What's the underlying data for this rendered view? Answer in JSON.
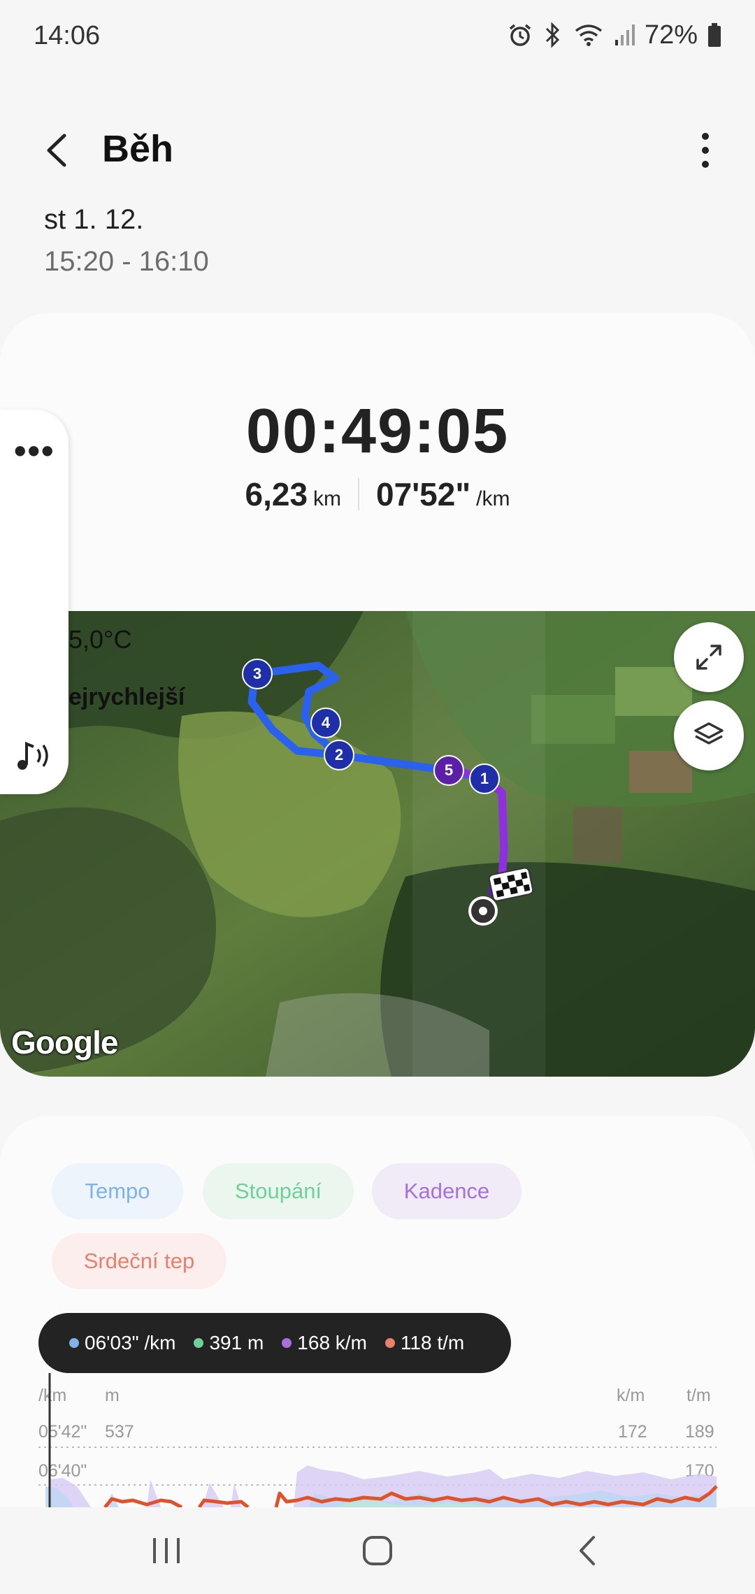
{
  "status": {
    "time": "14:06",
    "battery": "72%"
  },
  "header": {
    "title": "Běh"
  },
  "session": {
    "date": "st 1. 12.",
    "time_range": "15:20 - 16:10"
  },
  "summary": {
    "duration": "00:49:05",
    "distance_value": "6,23",
    "distance_unit": "km",
    "pace_value": "07'52\"",
    "pace_unit": "/km"
  },
  "map": {
    "temperature": "5,0°C",
    "fastest_label": "ejrychlejší",
    "attribution": "Google",
    "km_markers": [
      "1",
      "2",
      "3",
      "4",
      "5"
    ]
  },
  "chart": {
    "chips": {
      "tempo": "Tempo",
      "stoupani": "Stoupání",
      "kadence": "Kadence",
      "tep": "Srdeční tep"
    },
    "tooltip": {
      "pace": "06'03\" /km",
      "elevation": "391 m",
      "cadence": "168 k/m",
      "heart_rate": "118 t/m"
    },
    "axis_units": {
      "pace": "/km",
      "elevation": "m",
      "cadence": "k/m",
      "heart_rate": "t/m"
    },
    "ticks": {
      "pace_top": "05'42\"",
      "pace_second": "06'40\"",
      "elevation_top": "537",
      "cadence_top": "172",
      "heart_top": "189",
      "heart_second": "170"
    },
    "colors": {
      "pace": "#7fb2e8",
      "elevation": "#6fd19a",
      "cadence": "#a572db",
      "heart_rate": "#e8806b"
    }
  }
}
